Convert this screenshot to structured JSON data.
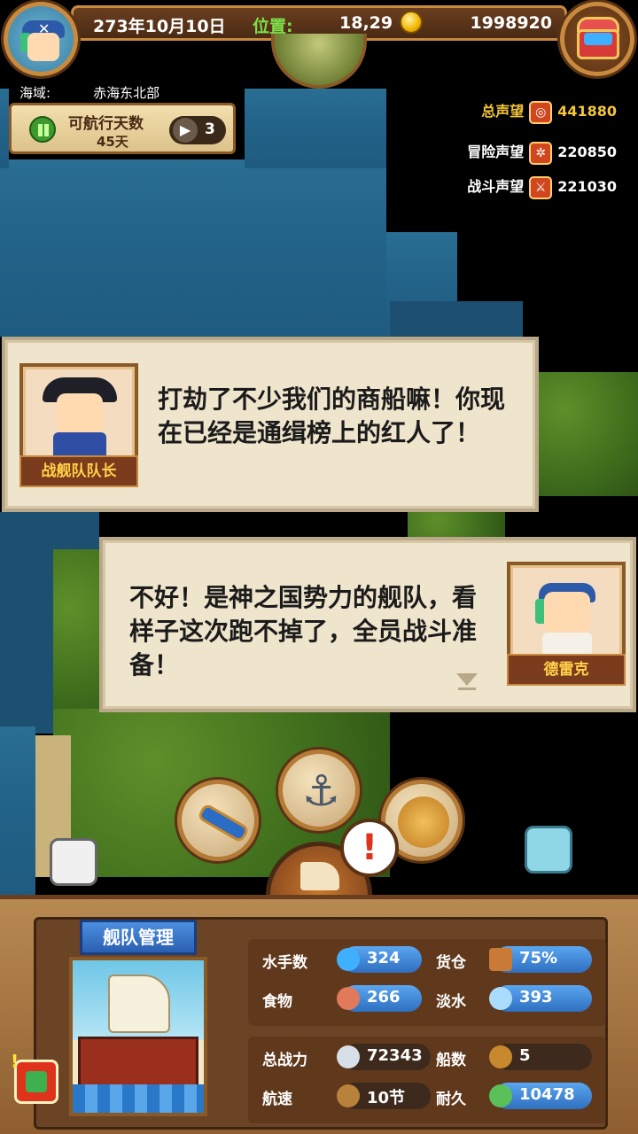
{
  "header": {
    "date": "273年10月10日",
    "position_label": "位置:",
    "position_value": "18,29",
    "gold": "1998920"
  },
  "sea_area": {
    "label": "海域:",
    "name": "赤海东北部"
  },
  "sail_days": {
    "label": "可航行天数",
    "value": "45天",
    "speed": "3"
  },
  "reputation": {
    "total_label": "总声望",
    "total_value": "441880",
    "adventure_label": "冒险声望",
    "adventure_value": "220850",
    "battle_label": "战斗声望",
    "battle_value": "221030"
  },
  "dialogs": [
    {
      "speaker": "战舰队队长",
      "text": "打劫了不少我们的商船嘛！你现在已经是通缉榜上的红人了！"
    },
    {
      "speaker": "德雷克",
      "text": "不好！是神之国势力的舰队，看样子这次跑不掉了，全员战斗准备！"
    }
  ],
  "alert_symbol": "!",
  "fleet": {
    "title": "舰队管理",
    "stats": {
      "sailors_label": "水手数",
      "sailors_value": "324",
      "cargo_label": "货仓",
      "cargo_value": "75%",
      "food_label": "食物",
      "food_value": "266",
      "water_label": "淡水",
      "water_value": "393",
      "power_label": "总战力",
      "power_value": "72343",
      "ships_label": "船数",
      "ships_value": "5",
      "speed_label": "航速",
      "speed_value": "10节",
      "durability_label": "耐久",
      "durability_value": "10478"
    }
  },
  "colors": {
    "accent_gold": "#f5c637",
    "position_green": "#7ee04a",
    "hud_brown": "#4a2a14",
    "stat_blue": "#2f6fc0",
    "alert_red": "#e0331c"
  },
  "icons": {
    "avatar": "pirate-bandana-avatar",
    "chest": "treasure-chest-icon",
    "coin": "gold-coin-icon",
    "tool_left": "spyglass-icon",
    "tool_center": "anchor-icon",
    "tool_right": "world-map-icon"
  }
}
